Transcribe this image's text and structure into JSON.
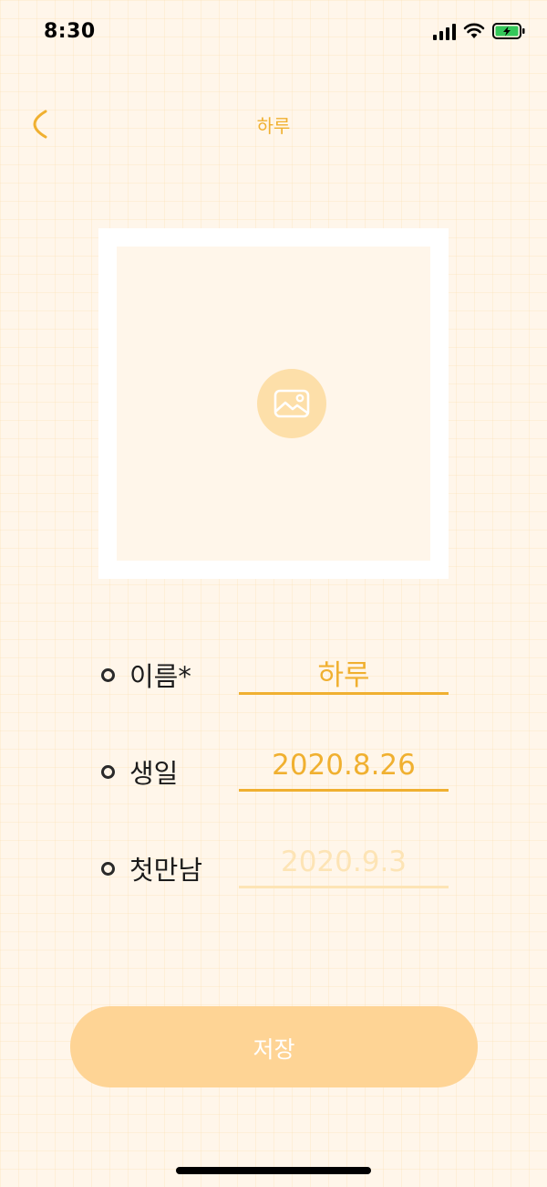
{
  "status_bar": {
    "time": "8:30",
    "icons": [
      "signal-icon",
      "wifi-icon",
      "battery-charging-icon"
    ]
  },
  "header": {
    "back_icon": "chevron-left-icon",
    "title": "하루"
  },
  "photo": {
    "icon": "image-icon"
  },
  "form": {
    "rows": [
      {
        "label": "이름*",
        "value": "하루",
        "state": "filled"
      },
      {
        "label": "생일",
        "value": "2020.8.26",
        "state": "filled"
      },
      {
        "label": "첫만남",
        "value": "2020.9.3",
        "state": "placeholder"
      }
    ]
  },
  "save": {
    "label": "저장"
  },
  "colors": {
    "accent": "#f0b030",
    "accent_faded": "#fde4b5",
    "button": "#fed495",
    "background": "#fff6ea",
    "photo_icon_bg": "#fddfa9"
  }
}
